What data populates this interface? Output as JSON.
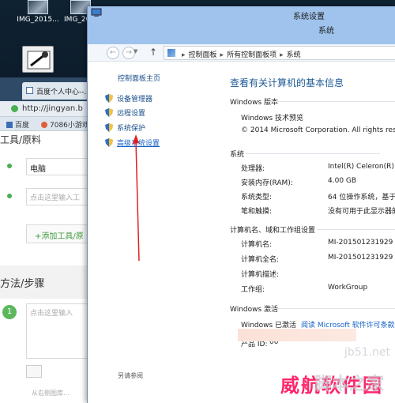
{
  "desktop": {
    "icons": [
      {
        "label": "IMG_2015..."
      },
      {
        "label": "IMG_20..."
      }
    ]
  },
  "browser": {
    "tab_title": "百度个人中心--...",
    "url": "http://jingyan.b",
    "bookmarks": [
      "百度",
      "7086小游戏"
    ],
    "section_title": "工具/原料",
    "tool_field_value": "电脑",
    "tool_field_placeholder": "点击这里输入工",
    "add_tool_button": "+添加工具/原",
    "steps_title": "方法/步骤",
    "step_number": "1",
    "step_placeholder": "点击这里输入",
    "image_hint": "从右侧图库..."
  },
  "control_panel": {
    "outer_title": "系统设置",
    "inner_title": "系统",
    "breadcrumb": [
      "控制面板",
      "所有控制面板项",
      "系统"
    ],
    "sidebar": {
      "home": "控制面板主页",
      "links": [
        {
          "label": "设备管理器",
          "icon": "shield-icon"
        },
        {
          "label": "远程设置",
          "icon": "shield-icon"
        },
        {
          "label": "系统保护",
          "icon": "shield-icon"
        },
        {
          "label": "高级系统设置",
          "icon": "shield-icon"
        }
      ],
      "see_also": "另请参阅"
    },
    "main": {
      "heading": "查看有关计算机的基本信息",
      "windows_edition": {
        "title": "Windows 版本",
        "name": "Windows 技术预览",
        "copyright": "© 2014 Microsoft Corporation. All rights rese"
      },
      "system": {
        "title": "系统",
        "rows": [
          {
            "label": "处理器:",
            "value": "Intel(R) Celeron(R) C"
          },
          {
            "label": "安装内存(RAM):",
            "value": "4.00 GB"
          },
          {
            "label": "系统类型:",
            "value": "64 位操作系统，基于"
          },
          {
            "label": "笔和触摸:",
            "value": "没有可用于此显示器的"
          }
        ]
      },
      "computer_name": {
        "title": "计算机名、域和工作组设置",
        "rows": [
          {
            "label": "计算机名:",
            "value": "MI-201501231929"
          },
          {
            "label": "计算机全名:",
            "value": "MI-201501231929"
          },
          {
            "label": "计算机描述:",
            "value": ""
          },
          {
            "label": "工作组:",
            "value": "WorkGroup"
          }
        ]
      },
      "activation": {
        "title": "Windows 激活",
        "status": "Windows 已激活",
        "link": "阅读 Microsoft 软件许可条款",
        "product_id_label": "产品 ID:",
        "product_id_value": "00"
      }
    }
  },
  "watermark": {
    "text_red": "威航软件园",
    "text_grey": "脚本之家",
    "text_small": "jb51.net"
  }
}
